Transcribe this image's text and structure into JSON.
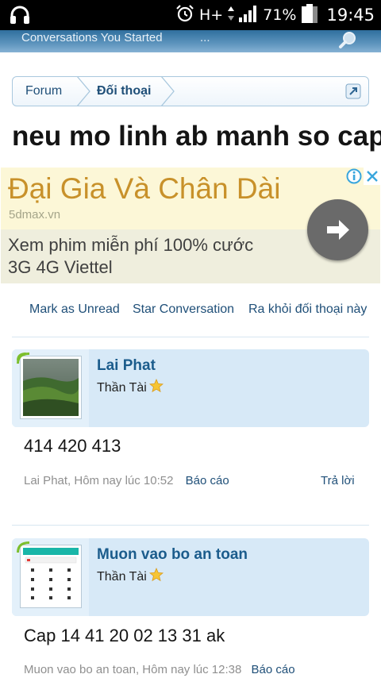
{
  "status_bar": {
    "network": "H+",
    "battery_percent": "71%",
    "time": "19:45"
  },
  "app_header": {
    "title": "Conversations You Started",
    "more": "..."
  },
  "breadcrumb": {
    "items": [
      "Forum",
      "Đối thoại"
    ]
  },
  "page": {
    "title": "neu mo linh ab manh so cap"
  },
  "ad": {
    "headline": "Đại Gia Và Chân Dài",
    "domain": "5dmax.vn",
    "description_line1": "Xem phim miễn phí 100% cước",
    "description_line2": "3G 4G Viettel"
  },
  "actions": {
    "mark_unread": "Mark as Unread",
    "star": "Star Conversation",
    "leave": "Ra khỏi đối thoại này"
  },
  "messages": [
    {
      "user": "Lai Phat",
      "role": "Thần Tài",
      "body": "414 420 413",
      "meta": "Lai Phat, Hôm nay lúc 10:52",
      "report": "Báo cáo",
      "reply": "Trả lời"
    },
    {
      "user": "Muon vao bo an toan",
      "role": "Thần Tài",
      "body": "Cap 14 41 20 02 13 31 ak",
      "meta": "Muon vao bo an toan, Hôm nay lúc 12:38",
      "report": "Báo cáo"
    }
  ],
  "colors": {
    "link": "#1f4f78",
    "header_bg": "#5d94bd",
    "message_header_bg": "#d7e9f7",
    "ad_headline": "#c8912a"
  }
}
